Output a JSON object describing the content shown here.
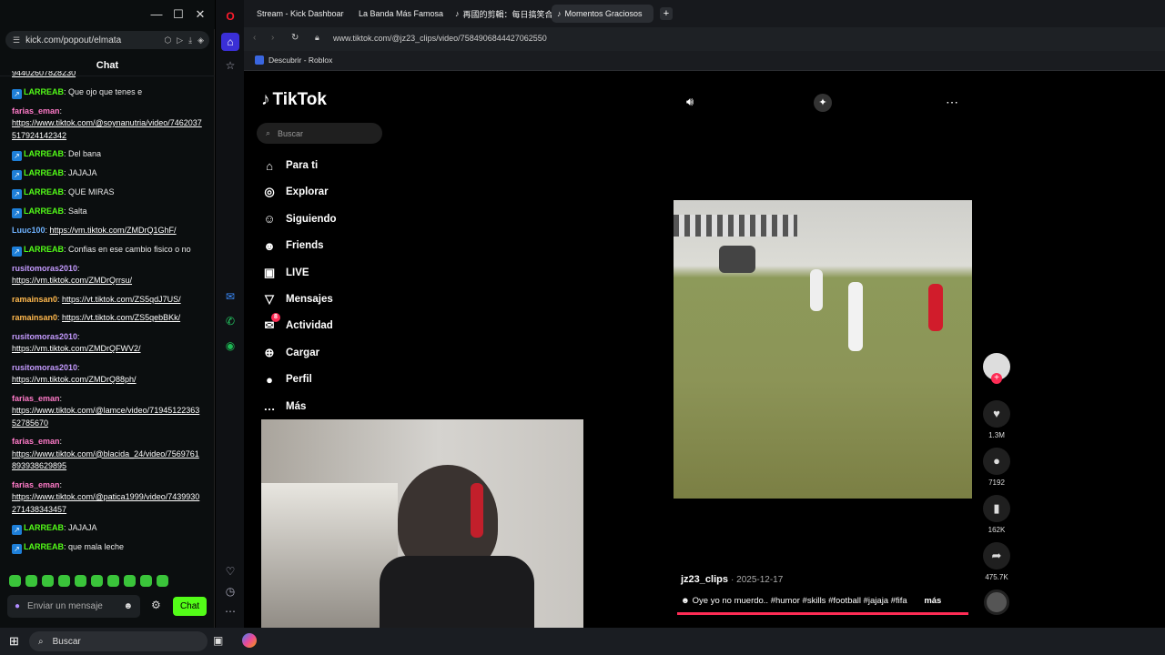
{
  "kick": {
    "url": "kick.com/popout/elmata",
    "chat_title": "Chat",
    "messages": [
      {
        "user": "LARREAB",
        "color": "u-green",
        "badge": true,
        "text": "Que ojo que tenes e"
      },
      {
        "user": "farias_eman",
        "color": "u-pink",
        "badge": false,
        "text": "",
        "link": "https://www.tiktok.com/@soynanutria/video/7462037517924142342"
      },
      {
        "user": "LARREAB",
        "color": "u-green",
        "badge": true,
        "text": "Del bana"
      },
      {
        "user": "LARREAB",
        "color": "u-green",
        "badge": true,
        "text": "JAJAJA"
      },
      {
        "user": "LARREAB",
        "color": "u-green",
        "badge": true,
        "text": "QUE MIRAS"
      },
      {
        "user": "LARREAB",
        "color": "u-green",
        "badge": true,
        "text": "Salta"
      },
      {
        "user": "Luuc100",
        "color": "u-blue",
        "badge": false,
        "text": "",
        "link": "https://vm.tiktok.com/ZMDrQ1GhF/"
      },
      {
        "user": "LARREAB",
        "color": "u-green",
        "badge": true,
        "text": "Confias en ese cambio fisico o no"
      },
      {
        "user": "rusitomoras2010",
        "color": "u-purple",
        "badge": false,
        "text": "",
        "link": "https://vm.tiktok.com/ZMDrQrrsu/"
      },
      {
        "user": "ramainsan0",
        "color": "u-orange",
        "badge": false,
        "text": "",
        "link": "https://vt.tiktok.com/ZS5qdJ7US/"
      },
      {
        "user": "ramainsan0",
        "color": "u-orange",
        "badge": false,
        "text": "",
        "link": "https://vt.tiktok.com/ZS5qebBKk/"
      },
      {
        "user": "rusitomoras2010",
        "color": "u-purple",
        "badge": false,
        "text": "",
        "link": "https://vm.tiktok.com/ZMDrQFWV2/"
      },
      {
        "user": "rusitomoras2010",
        "color": "u-purple",
        "badge": false,
        "text": "",
        "link": "https://vm.tiktok.com/ZMDrQ88ph/"
      },
      {
        "user": "farias_eman",
        "color": "u-pink",
        "badge": false,
        "text": "",
        "link": "https://www.tiktok.com/@lamce/video/7194512236352785670"
      },
      {
        "user": "farias_eman",
        "color": "u-pink",
        "badge": false,
        "text": "",
        "link": "https://www.tiktok.com/@blacida_24/video/7569761893938629895"
      },
      {
        "user": "farias_eman",
        "color": "u-pink",
        "badge": false,
        "text": "",
        "link": "https://www.tiktok.com/@patica1999/video/7439930271438343457"
      },
      {
        "user": "LARREAB",
        "color": "u-green",
        "badge": true,
        "text": "JAJAJA"
      },
      {
        "user": "LARREAB",
        "color": "u-green",
        "badge": true,
        "text": "que mala leche"
      }
    ],
    "top_partial": "94402607828230",
    "input_placeholder": "Enviar un mensaje",
    "chat_button": "Chat"
  },
  "tabs": [
    {
      "label": "Stream - Kick Dashboard",
      "color": "#53fc18"
    },
    {
      "label": "La Banda Más Famosa de",
      "color": "#ff3030"
    },
    {
      "label": "再國的剪輯：每日搞笑合",
      "color": "#ffffff"
    },
    {
      "label": "Momentos Graciosos",
      "color": "#ffffff",
      "active": true
    }
  ],
  "browser": {
    "url": "www.tiktok.com/@jz23_clips/video/7584906844427062550",
    "bookmark": "Descubrir - Roblox"
  },
  "tiktok": {
    "logo": "TikTok",
    "search_placeholder": "Buscar",
    "nav": [
      {
        "icon": "⌂",
        "label": "Para ti"
      },
      {
        "icon": "◎",
        "label": "Explorar"
      },
      {
        "icon": "☺",
        "label": "Siguiendo"
      },
      {
        "icon": "☻",
        "label": "Friends"
      },
      {
        "icon": "▣",
        "label": "LIVE"
      },
      {
        "icon": "▽",
        "label": "Mensajes"
      },
      {
        "icon": "✉",
        "label": "Actividad"
      },
      {
        "icon": "⊕",
        "label": "Cargar"
      },
      {
        "icon": "●",
        "label": "Perfil"
      },
      {
        "icon": "…",
        "label": "Más"
      }
    ],
    "activity_badge": "8",
    "likes": "1.3M",
    "comments": "7192",
    "saves": "162K",
    "shares": "475.7K",
    "author": "jz23_clips",
    "date": "2025-12-17",
    "caption": "Oye yo no muerdo.. #humor #skills #football #jajaja #fifa",
    "more": "más"
  },
  "taskbar": {
    "search": "Buscar"
  }
}
